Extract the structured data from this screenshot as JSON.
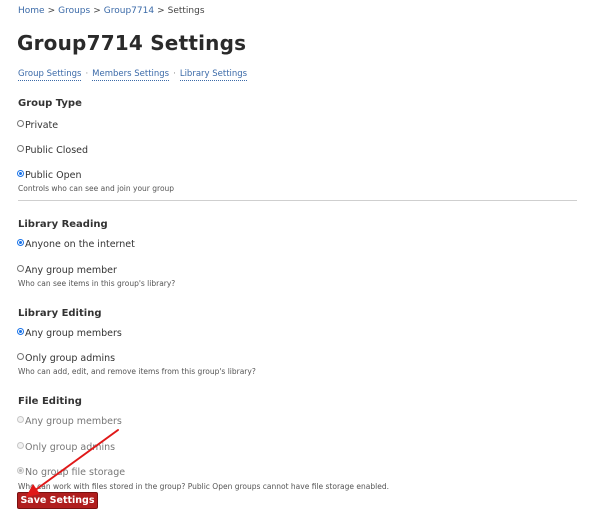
{
  "breadcrumb": {
    "items": [
      "Home",
      "Groups",
      "Group7714"
    ],
    "current": "Settings",
    "separator": ">"
  },
  "page_title": "Group7714 Settings",
  "subnav": {
    "items": [
      "Group Settings",
      "Members Settings",
      "Library Settings"
    ],
    "separator": "·"
  },
  "sections": [
    {
      "heading": "Group Type",
      "options": [
        {
          "label": "Private",
          "checked": false,
          "disabled": false
        },
        {
          "label": "Public Closed",
          "checked": false,
          "disabled": false
        },
        {
          "label": "Public Open",
          "checked": true,
          "disabled": false
        }
      ],
      "help": "Controls who can see and join your group"
    },
    {
      "heading": "Library Reading",
      "options": [
        {
          "label": "Anyone on the internet",
          "checked": true,
          "disabled": false
        },
        {
          "label": "Any group member",
          "checked": false,
          "disabled": false
        }
      ],
      "help": "Who can see items in this group's library?"
    },
    {
      "heading": "Library Editing",
      "options": [
        {
          "label": "Any group members",
          "checked": true,
          "disabled": false
        },
        {
          "label": "Only group admins",
          "checked": false,
          "disabled": false
        }
      ],
      "help": "Who can add, edit, and remove items from this group's library?"
    },
    {
      "heading": "File Editing",
      "options": [
        {
          "label": "Any group members",
          "checked": false,
          "disabled": true
        },
        {
          "label": "Only group admins",
          "checked": false,
          "disabled": true
        },
        {
          "label": "No group file storage",
          "checked": true,
          "disabled": true
        }
      ],
      "help": "Who can work with files stored in the group? Public Open groups cannot have file storage enabled."
    }
  ],
  "save_button_label": "Save Settings",
  "colors": {
    "link": "#3b6aa8",
    "save_button": "#b01e1e",
    "annotation_arrow": "#e01818",
    "radio_checked": "#1a73e8"
  }
}
